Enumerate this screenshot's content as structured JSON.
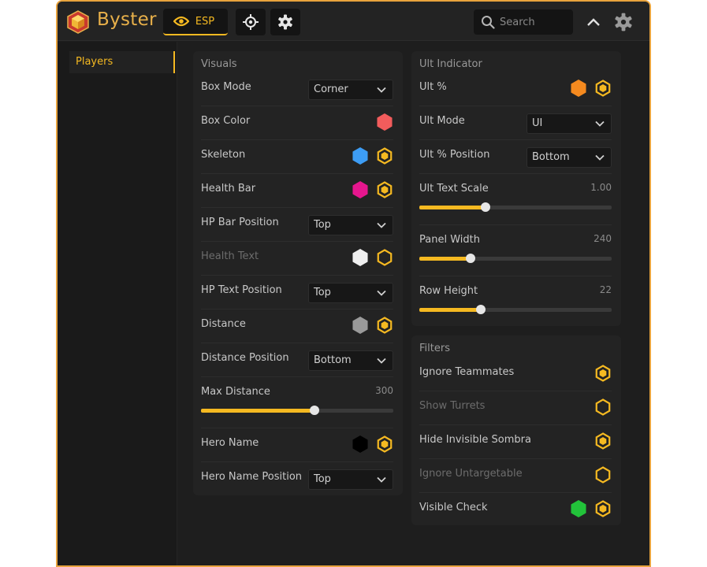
{
  "app": {
    "brand": "Byster"
  },
  "toolbar": {
    "esp_label": "ESP",
    "search_placeholder": "Search"
  },
  "sidebar": {
    "items": [
      {
        "label": "Players",
        "active": true
      }
    ]
  },
  "visuals": {
    "title": "Visuals",
    "rows": [
      {
        "label": "Box Mode",
        "value": "Corner"
      },
      {
        "label": "Box Color",
        "color": "#f25c5c"
      },
      {
        "label": "Skeleton",
        "color": "#3d9df5",
        "toggle": true
      },
      {
        "label": "Health Bar",
        "color": "#e6168e",
        "toggle": true
      },
      {
        "label": "HP Bar Position",
        "value": "Top"
      },
      {
        "label": "Health Text",
        "color": "#f0f0f0",
        "toggle": false
      },
      {
        "label": "HP Text Position",
        "value": "Top"
      },
      {
        "label": "Distance",
        "color": "#9a9a9a",
        "toggle": true
      },
      {
        "label": "Distance Position",
        "value": "Bottom"
      },
      {
        "label": "Max Distance",
        "value": "300",
        "fraction": 0.59
      },
      {
        "label": "Hero Name",
        "color": "#000000",
        "toggle": true
      },
      {
        "label": "Hero Name Position",
        "value": "Top"
      }
    ]
  },
  "ult": {
    "title": "Ult Indicator",
    "rows": [
      {
        "label": "Ult %",
        "color": "#f58a1f",
        "toggle": true
      },
      {
        "label": "Ult Mode",
        "value": "UI"
      },
      {
        "label": "Ult % Position",
        "value": "Bottom"
      },
      {
        "label": "Ult Text Scale",
        "value": "1.00",
        "fraction": 0.345
      },
      {
        "label": "Panel Width",
        "value": "240",
        "fraction": 0.265
      },
      {
        "label": "Row Height",
        "value": "22",
        "fraction": 0.32
      }
    ]
  },
  "filters": {
    "title": "Filters",
    "rows": [
      {
        "label": "Ignore Teammates",
        "toggle": true
      },
      {
        "label": "Show Turrets",
        "toggle": false
      },
      {
        "label": "Hide Invisible Sombra",
        "toggle": true
      },
      {
        "label": "Ignore Untargetable",
        "toggle": false
      },
      {
        "label": "Visible Check",
        "color": "#22c33a",
        "toggle": true
      }
    ]
  },
  "colors": {
    "accent": "#f5b921",
    "brand": "#e8b04a",
    "border": "#e8a33d"
  }
}
